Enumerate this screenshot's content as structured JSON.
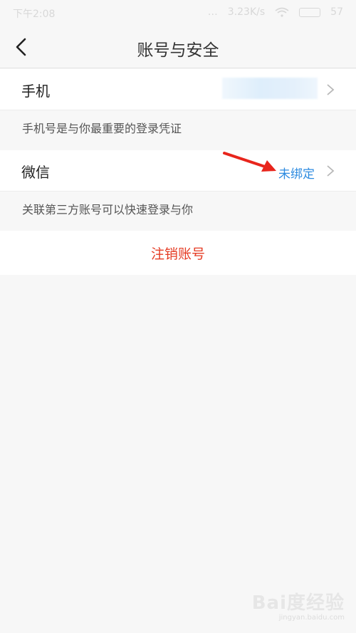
{
  "status_bar": {
    "time": "下午2:08",
    "network_speed": "3.23K/s",
    "battery": "57"
  },
  "header": {
    "title": "账号与安全"
  },
  "phone_section": {
    "label": "手机",
    "value_obscured": true,
    "hint": "手机号是与你最重要的登录凭证"
  },
  "wechat_section": {
    "label": "微信",
    "status": "未绑定",
    "hint": "关联第三方账号可以快速登录与你"
  },
  "cancel_account": {
    "label": "注销账号"
  },
  "colors": {
    "accent_blue": "#2d8be0",
    "danger_red": "#e53c24",
    "annotation_red": "#e8251c",
    "background": "#f7f7f7"
  },
  "icons": [
    "back-arrow-icon",
    "chevron-right-icon",
    "wifi-icon",
    "battery-icon",
    "signal-icon"
  ],
  "watermark": {
    "brand": "Bai度经验",
    "url": "jingyan.baidu.com"
  }
}
